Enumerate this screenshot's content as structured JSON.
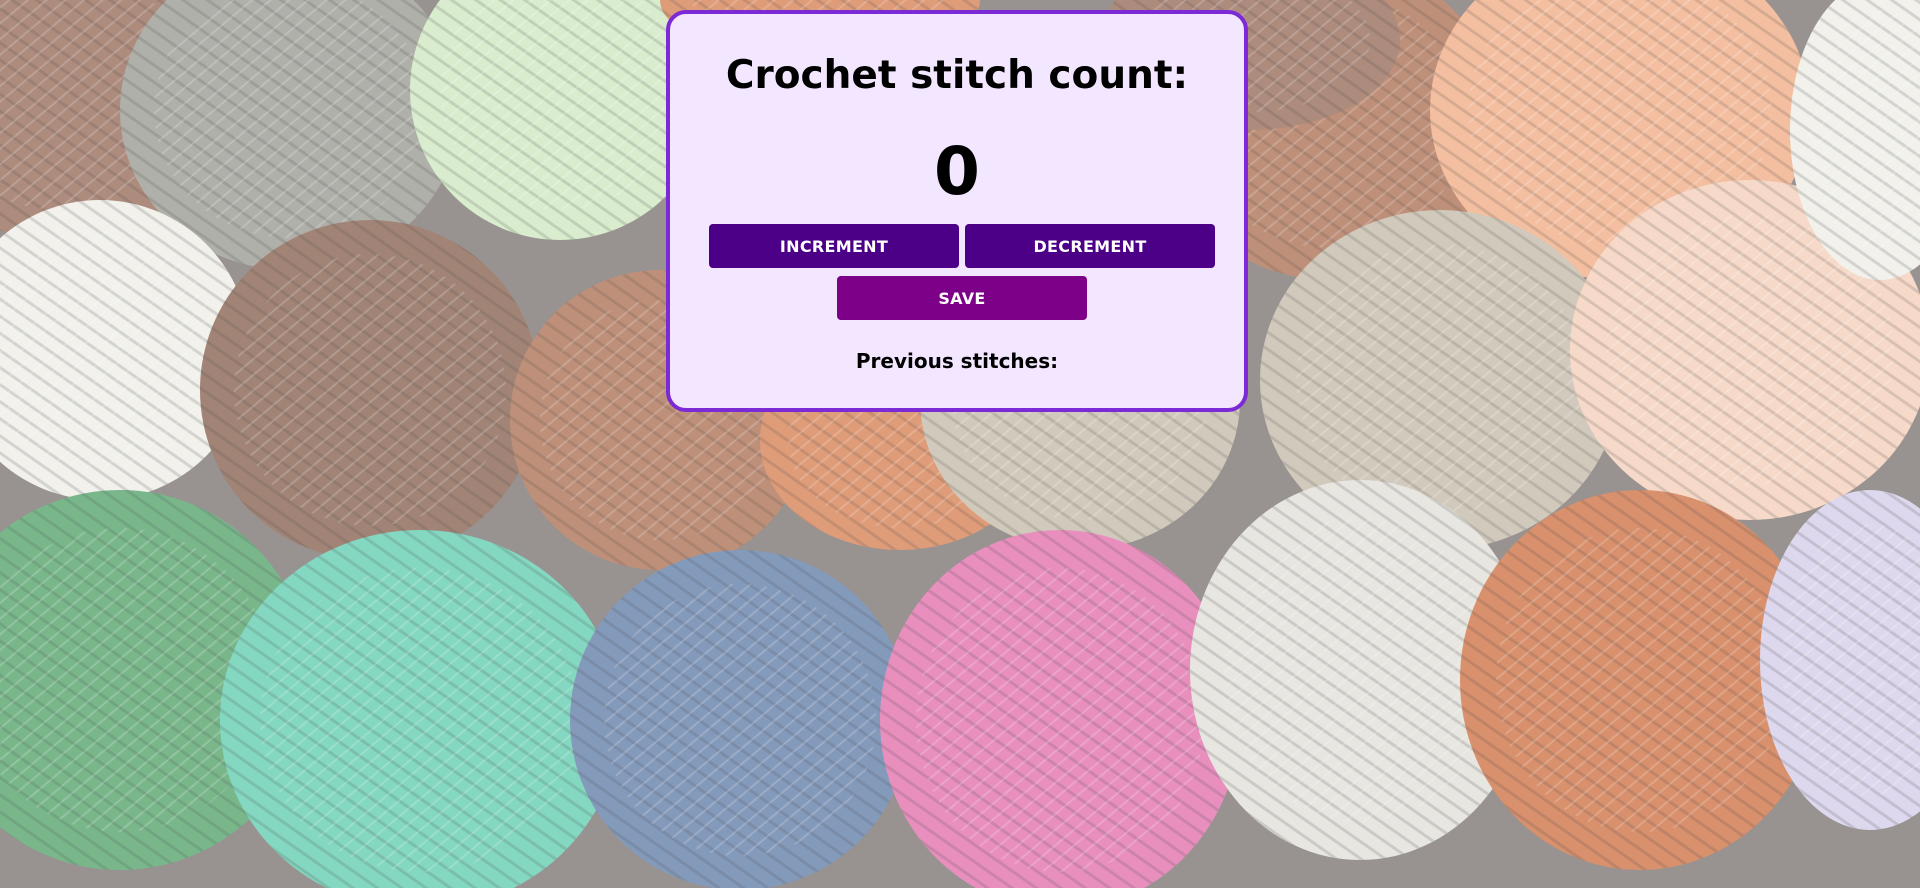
{
  "title": "Crochet stitch count:",
  "count": "0",
  "buttons": {
    "increment": "INCREMENT",
    "decrement": "DECREMENT",
    "save": "SAVE"
  },
  "previous_label": "Previous stitches:",
  "previous_stitches": [],
  "background": {
    "description": "yarn-balls-photo",
    "yarn_colors": [
      "#8a5a46",
      "#8e8e86",
      "#c9e5b9",
      "#a4603f",
      "#f0a477",
      "#ecebe4",
      "#7a4f3b",
      "#d2713f",
      "#e6e1d6",
      "#bdb3a0",
      "#f3c9b1",
      "#40995a",
      "#4fc6a6",
      "#4f6f9e",
      "#de5fa3",
      "#dddcd4",
      "#c8612e",
      "#cfc8e6"
    ]
  },
  "colors": {
    "card_bg": "#f3e6ff",
    "card_border": "#7b2ad6",
    "button_primary": "#4b0087",
    "button_save": "#7d0088"
  }
}
